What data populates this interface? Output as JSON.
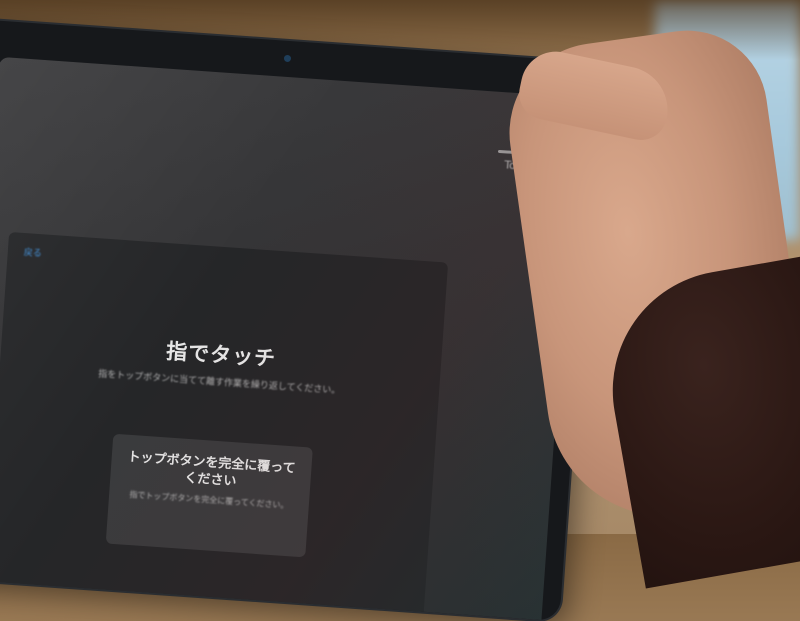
{
  "device": {
    "top_right_label": "Touch ID"
  },
  "screen": {
    "back_link": "戻る",
    "title": "指でタッチ",
    "instruction": "指をトップボタンに当てて離す作業を繰り返してください。",
    "hint": {
      "title_line1": "トップボタンを完全に覆って",
      "title_line2": "ください",
      "subtitle": "指でトップボタンを完全に覆ってください。"
    }
  }
}
